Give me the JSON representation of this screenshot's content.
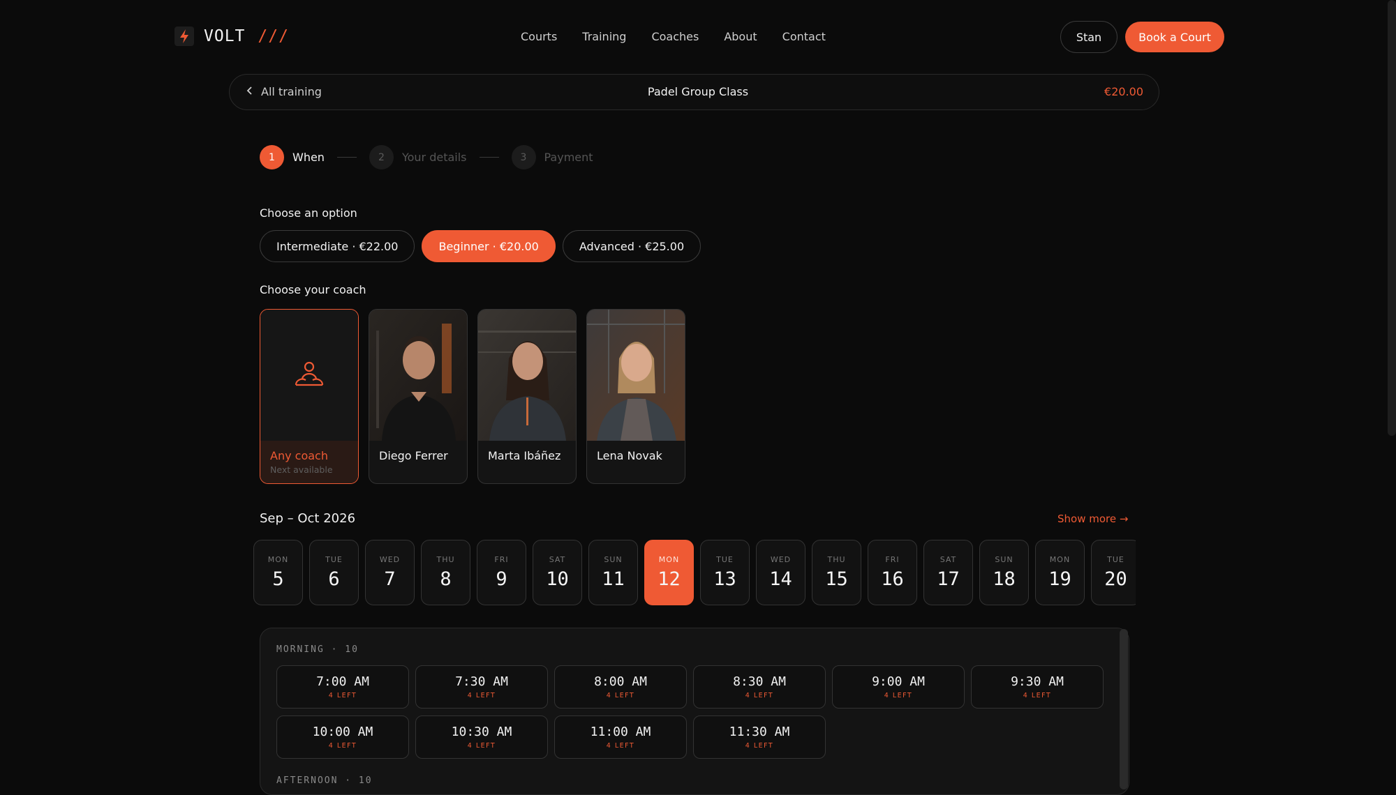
{
  "brand": {
    "name": "VOLT",
    "slashes": "///",
    "accent": "#ef5a34"
  },
  "nav": {
    "items": [
      "Courts",
      "Training",
      "Coaches",
      "About",
      "Contact"
    ]
  },
  "header": {
    "user_label": "Stan",
    "book_label": "Book a Court"
  },
  "context": {
    "back_label": "All training",
    "title": "Padel Group Class",
    "price": "€20.00"
  },
  "stepper": {
    "steps": [
      {
        "num": "1",
        "label": "When"
      },
      {
        "num": "2",
        "label": "Your details"
      },
      {
        "num": "3",
        "label": "Payment"
      }
    ]
  },
  "options": {
    "title": "Choose an option",
    "items": [
      "Intermediate · €22.00",
      "Beginner · €20.00",
      "Advanced · €25.00"
    ],
    "selected": "Beginner · €20.00"
  },
  "coaches": {
    "title": "Choose your coach",
    "any": {
      "name": "Any coach",
      "sub": "Next available"
    },
    "items": [
      "Diego Ferrer",
      "Marta Ibáñez",
      "Lena Novak"
    ]
  },
  "dates": {
    "range": "Sep – Oct 2026",
    "show_more": "Show more →",
    "days": [
      {
        "dow": "MON",
        "num": "5"
      },
      {
        "dow": "TUE",
        "num": "6"
      },
      {
        "dow": "WED",
        "num": "7"
      },
      {
        "dow": "THU",
        "num": "8"
      },
      {
        "dow": "FRI",
        "num": "9"
      },
      {
        "dow": "SAT",
        "num": "10"
      },
      {
        "dow": "SUN",
        "num": "11"
      },
      {
        "dow": "MON",
        "num": "12"
      },
      {
        "dow": "TUE",
        "num": "13"
      },
      {
        "dow": "WED",
        "num": "14"
      },
      {
        "dow": "THU",
        "num": "15"
      },
      {
        "dow": "FRI",
        "num": "16"
      },
      {
        "dow": "SAT",
        "num": "17"
      },
      {
        "dow": "SUN",
        "num": "18"
      },
      {
        "dow": "MON",
        "num": "19"
      },
      {
        "dow": "TUE",
        "num": "20"
      }
    ],
    "selected": "12"
  },
  "slots": {
    "morning_title": "MORNING · 10",
    "afternoon_title": "AFTERNOON · 10",
    "items": [
      {
        "time": "7:00 AM",
        "left": "4 LEFT"
      },
      {
        "time": "7:30 AM",
        "left": "4 LEFT"
      },
      {
        "time": "8:00 AM",
        "left": "4 LEFT"
      },
      {
        "time": "8:30 AM",
        "left": "4 LEFT"
      },
      {
        "time": "9:00 AM",
        "left": "4 LEFT"
      },
      {
        "time": "9:30 AM",
        "left": "4 LEFT"
      },
      {
        "time": "10:00 AM",
        "left": "4 LEFT"
      },
      {
        "time": "10:30 AM",
        "left": "4 LEFT"
      },
      {
        "time": "11:00 AM",
        "left": "4 LEFT"
      },
      {
        "time": "11:30 AM",
        "left": "4 LEFT"
      }
    ]
  }
}
